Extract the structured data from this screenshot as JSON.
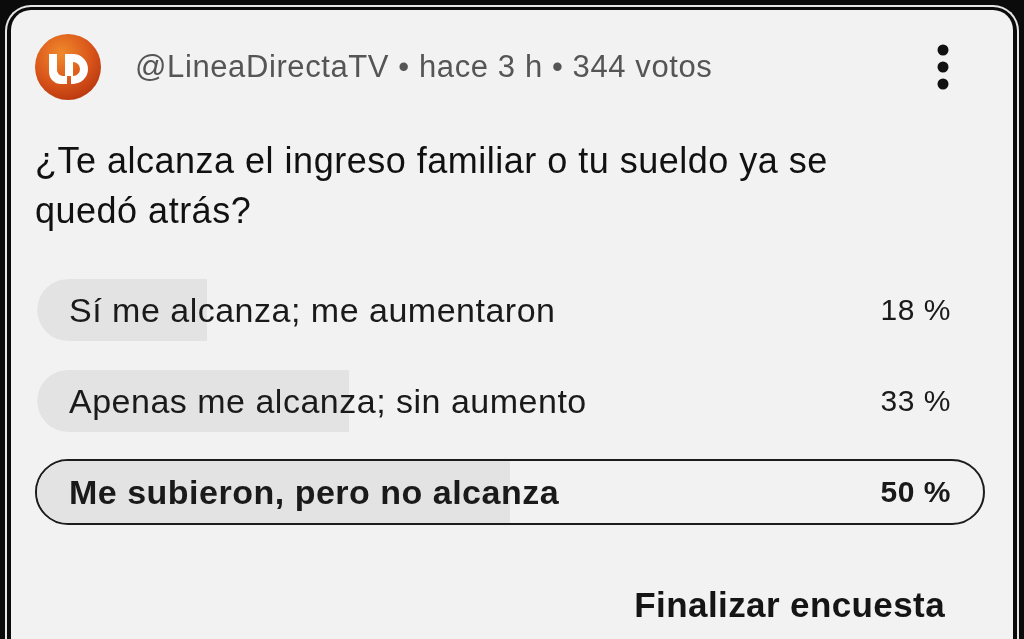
{
  "post": {
    "meta": "@LineaDirectaTV • hace 3 h • 344 votos"
  },
  "question": "¿Te alcanza el ingreso familiar o tu sueldo ya se quedó atrás?",
  "options": [
    {
      "label": "Sí me alcanza; me aumentaron",
      "percent": "18 %",
      "level": 0.18,
      "selected": false
    },
    {
      "label": "Apenas me alcanza; sin aumento",
      "percent": "33 %",
      "level": 0.33,
      "selected": false
    },
    {
      "label": "Me subieron, pero no alcanza",
      "percent": "50 %",
      "level": 0.5,
      "selected": true
    }
  ],
  "end_button": "Finalizar encuesta"
}
